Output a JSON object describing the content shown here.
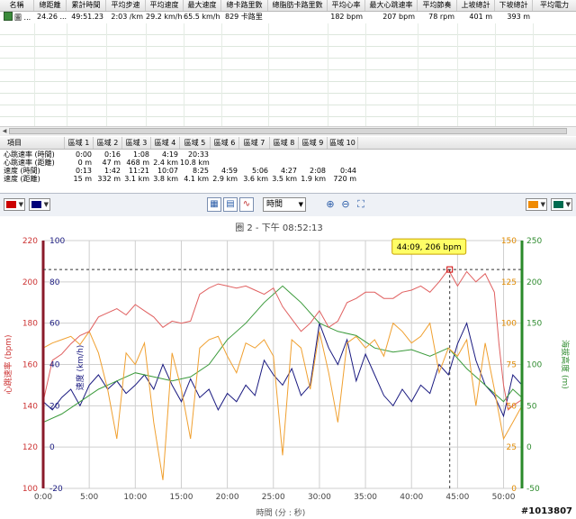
{
  "summary_table": {
    "headers": [
      "名稱",
      "總距離",
      "累計時間",
      "平均步速",
      "平均速度",
      "最大速度",
      "總卡路里數",
      "總脂肪卡路里數",
      "平均心率",
      "最大心跳速率",
      "平均節奏",
      "上坡總計",
      "下坡總計",
      "平均電力"
    ],
    "row": {
      "name": "圖 ...",
      "distance": "24.26 ...",
      "total_time": "49:51.23",
      "avg_pace": "2:03 /km",
      "avg_speed": "29.2 km/h",
      "max_speed": "65.5 km/h",
      "calories": "829 卡路里",
      "fat_calories": "",
      "avg_hr": "182 bpm",
      "max_hr": "207 bpm",
      "avg_cadence": "78 rpm",
      "ascent": "401 m",
      "descent": "393 m",
      "avg_power": ""
    }
  },
  "zone_table": {
    "headers": [
      "項目",
      "區域 1",
      "區域 2",
      "區域 3",
      "區域 4",
      "區域 5",
      "區域 6",
      "區域 7",
      "區域 8",
      "區域 9",
      "區域 10"
    ],
    "rows": [
      {
        "label": "心跳速率 (時間)",
        "values": [
          "0:00",
          "0:16",
          "1:08",
          "4:19",
          "20:33",
          "",
          "",
          "",
          "",
          ""
        ]
      },
      {
        "label": "心跳速率 (距離)",
        "values": [
          "0 m",
          "47 m",
          "468 m",
          "2.4 km",
          "10.8 km",
          "",
          "",
          "",
          "",
          ""
        ]
      },
      {
        "label": "速度 (時間)",
        "values": [
          "0:13",
          "1:42",
          "11:21",
          "10:07",
          "8:25",
          "4:59",
          "5:06",
          "4:27",
          "2:08",
          "0:44"
        ]
      },
      {
        "label": "速度 (距離)",
        "values": [
          "15 m",
          "332 m",
          "3.1 km",
          "3.8 km",
          "4.1 km",
          "2.9 km",
          "3.6 km",
          "3.5 km",
          "1.9 km",
          "720 m"
        ]
      }
    ]
  },
  "toolbar": {
    "left_colors": [
      "#cc0000",
      "#00007a"
    ],
    "right_colors": [
      "#f08a00",
      "#006b4f"
    ],
    "x_axis_mode": "時間",
    "icons": [
      "chart-grid-icon",
      "chart-split-icon",
      "chart-smooth-icon",
      "zoom-in-icon",
      "zoom-out-icon",
      "zoom-fit-icon"
    ]
  },
  "chart_data": {
    "type": "line",
    "title": "圈 2 - 下午 08:52:13",
    "xlabel": "時間 (分 : 秒)",
    "x_ticks": [
      "0:00",
      "5:00",
      "10:00",
      "15:00",
      "20:00",
      "25:00",
      "30:00",
      "35:00",
      "40:00",
      "45:00",
      "50:00"
    ],
    "x_range_min": [
      0,
      52
    ],
    "axes": {
      "hr": {
        "label": "心跳速率 (bpm)",
        "ticks": [
          100,
          120,
          140,
          160,
          180,
          200,
          220
        ],
        "range": [
          100,
          220
        ],
        "color": "#cc3333"
      },
      "speed": {
        "label": "速度 (km/h)",
        "ticks": [
          -20,
          0,
          20,
          40,
          60,
          80,
          100
        ],
        "range": [
          -20,
          100
        ],
        "color": "#1a1a80"
      },
      "cadence": {
        "label": "",
        "ticks": [
          0,
          25,
          50,
          75,
          100,
          125,
          150
        ],
        "range": [
          0,
          150
        ],
        "color": "#e08a00"
      },
      "altitude": {
        "label": "海拔高度 (m)",
        "ticks": [
          -50,
          0,
          50,
          100,
          150,
          200,
          250
        ],
        "range": [
          -50,
          250
        ],
        "color": "#2e8b2e"
      }
    },
    "marker": {
      "label": "44:09, 206 bpm",
      "x_min": 44.15,
      "hr": 206
    },
    "series": [
      {
        "axis": "hr",
        "color": "#e06060",
        "x": [
          0,
          1,
          2,
          3,
          4,
          5,
          6,
          7,
          8,
          9,
          10,
          11,
          12,
          13,
          14,
          15,
          16,
          17,
          18,
          19,
          20,
          21,
          22,
          23,
          24,
          25,
          26,
          27,
          28,
          29,
          30,
          31,
          32,
          33,
          34,
          35,
          36,
          37,
          38,
          39,
          40,
          41,
          42,
          43,
          44,
          45,
          46,
          47,
          48,
          49,
          49.5,
          50,
          50.5,
          51,
          52
        ],
        "values": [
          142,
          162,
          165,
          170,
          174,
          176,
          183,
          185,
          187,
          184,
          189,
          186,
          183,
          178,
          181,
          180,
          181,
          194,
          197,
          199,
          198,
          197,
          198,
          196,
          194,
          197,
          188,
          182,
          176,
          180,
          186,
          178,
          181,
          190,
          192,
          195,
          195,
          192,
          192,
          195,
          196,
          198,
          195,
          200,
          206,
          198,
          205,
          200,
          204,
          195,
          170,
          150,
          138,
          140,
          143
        ]
      },
      {
        "axis": "speed",
        "color": "#1a1a80",
        "x": [
          0,
          1,
          2,
          3,
          4,
          5,
          6,
          7,
          8,
          9,
          10,
          11,
          12,
          13,
          14,
          15,
          16,
          17,
          18,
          19,
          20,
          21,
          22,
          23,
          24,
          25,
          26,
          27,
          28,
          29,
          30,
          31,
          32,
          33,
          34,
          35,
          36,
          37,
          38,
          39,
          40,
          41,
          42,
          43,
          44,
          45,
          46,
          47,
          48,
          49,
          50,
          51,
          52
        ],
        "values": [
          22,
          18,
          24,
          28,
          20,
          30,
          35,
          28,
          32,
          26,
          30,
          35,
          28,
          40,
          30,
          22,
          33,
          24,
          28,
          18,
          26,
          22,
          30,
          25,
          42,
          35,
          30,
          38,
          25,
          30,
          60,
          48,
          40,
          52,
          32,
          45,
          35,
          25,
          20,
          28,
          22,
          30,
          26,
          40,
          35,
          50,
          60,
          42,
          30,
          25,
          15,
          35,
          30
        ]
      },
      {
        "axis": "cadence",
        "color": "#f0a030",
        "x": [
          0,
          1,
          2,
          3,
          4,
          5,
          6,
          7,
          8,
          9,
          10,
          11,
          12,
          13,
          14,
          15,
          16,
          17,
          18,
          19,
          20,
          21,
          22,
          23,
          24,
          25,
          26,
          27,
          28,
          29,
          30,
          31,
          32,
          33,
          34,
          35,
          36,
          37,
          38,
          39,
          40,
          41,
          42,
          43,
          44,
          45,
          46,
          47,
          48,
          49,
          50,
          51,
          52
        ],
        "values": [
          85,
          88,
          90,
          92,
          87,
          95,
          82,
          60,
          30,
          82,
          75,
          88,
          40,
          5,
          82,
          60,
          30,
          85,
          90,
          92,
          80,
          70,
          88,
          85,
          90,
          80,
          20,
          90,
          85,
          60,
          95,
          70,
          40,
          88,
          92,
          85,
          90,
          80,
          100,
          95,
          88,
          92,
          100,
          70,
          85,
          80,
          90,
          50,
          88,
          60,
          30,
          40,
          50
        ]
      },
      {
        "axis": "altitude",
        "color": "#3a9a3a",
        "x": [
          0,
          2,
          4,
          6,
          8,
          10,
          12,
          14,
          16,
          18,
          20,
          22,
          24,
          26,
          27,
          28,
          30,
          32,
          34,
          36,
          38,
          40,
          42,
          44,
          46,
          48,
          50,
          51,
          52
        ],
        "values": [
          30,
          40,
          55,
          70,
          80,
          90,
          85,
          80,
          85,
          100,
          130,
          150,
          175,
          195,
          185,
          175,
          150,
          140,
          135,
          120,
          115,
          118,
          110,
          120,
          95,
          75,
          55,
          70,
          60
        ]
      }
    ]
  },
  "watermark": "#1013807"
}
